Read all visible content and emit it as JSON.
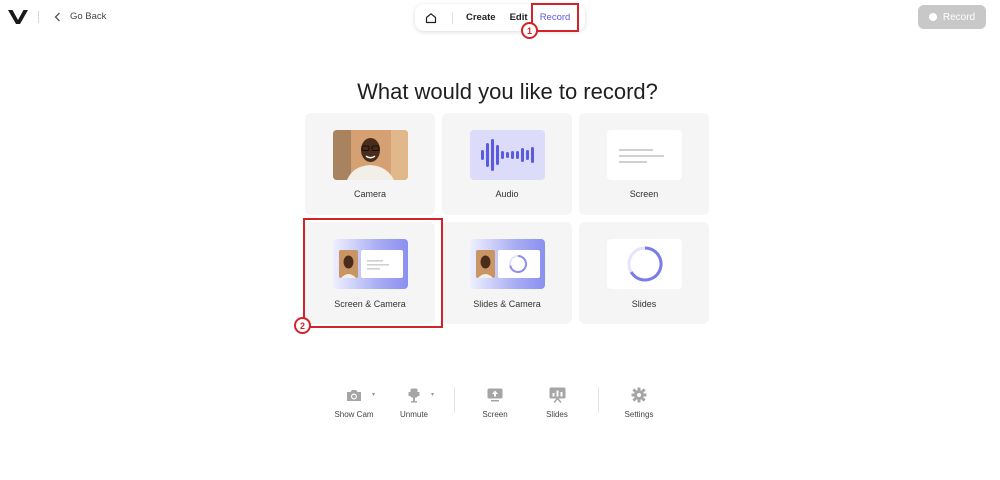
{
  "header": {
    "go_back": "Go Back",
    "nav": {
      "create": "Create",
      "edit": "Edit",
      "record": "Record"
    },
    "record_button": "Record"
  },
  "callouts": [
    "1",
    "2"
  ],
  "main": {
    "title": "What would you like to record?",
    "options": [
      {
        "label": "Camera"
      },
      {
        "label": "Audio"
      },
      {
        "label": "Screen"
      },
      {
        "label": "Screen & Camera"
      },
      {
        "label": "Slides & Camera"
      },
      {
        "label": "Slides"
      }
    ]
  },
  "toolbar": {
    "show_cam": "Show Cam",
    "unmute": "Unmute",
    "screen": "Screen",
    "slides": "Slides",
    "settings": "Settings"
  },
  "colors": {
    "accent": "#5b5be2",
    "annotation": "#d2232a",
    "record_disabled": "#c8c8c8",
    "card_bg": "#f5f5f5"
  }
}
